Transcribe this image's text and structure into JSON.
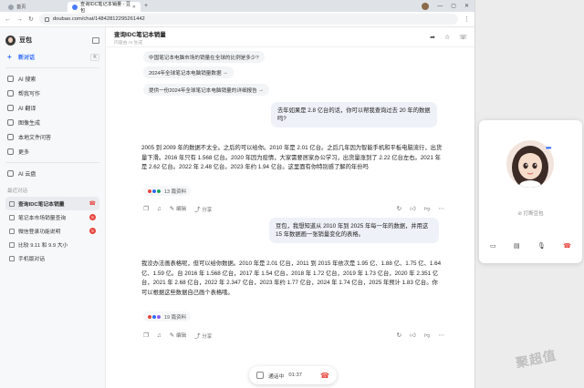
{
  "browser": {
    "tabs": [
      {
        "label": "首页",
        "active": false
      },
      {
        "label": "查询IDC笔记本销量 - 豆包",
        "active": true
      }
    ],
    "url": "doubao.com/chat/14842812295261442"
  },
  "sidebar": {
    "title": "豆包",
    "new_chat": "新对话",
    "new_chat_kbd": "K",
    "items": [
      {
        "label": "AI 搜索",
        "icon": "search-icon"
      },
      {
        "label": "帮我写作",
        "icon": "pen-icon"
      },
      {
        "label": "AI 翻译",
        "icon": "translate-icon"
      },
      {
        "label": "图像生成",
        "icon": "image-icon"
      },
      {
        "label": "本地文件问答",
        "icon": "file-icon"
      },
      {
        "label": "更多",
        "icon": "more-icon"
      }
    ],
    "cloud": "AI 云盘",
    "history_title": "最近对话",
    "history": [
      {
        "label": "查询IDC笔记本销量",
        "active": true,
        "badge": ""
      },
      {
        "label": "笔记本市场销量查询",
        "active": false,
        "badge": "5"
      },
      {
        "label": "微信登录功能说明",
        "active": false,
        "badge": "5"
      },
      {
        "label": "比较 9.11 和 9.9 大小",
        "active": false,
        "badge": ""
      },
      {
        "label": "手机版对话",
        "active": false,
        "badge": ""
      }
    ]
  },
  "chat": {
    "title": "查询IDC笔记本销量",
    "subtitle": "内容由 AI 生成",
    "chips": [
      "中国笔记本电脑市场的销量在全球的比例是多少?",
      "2024年全球笔记本电脑销量数据",
      "提供一份2024年全球笔记本电脑销量的详细报告"
    ],
    "user_msg_1": "去年如果是 2.8 亿台的话，你可以帮我查询过去 20 年的数据吗?",
    "reply_1": "2005 到 2009 年的数据不太全。之后的可以给你。2010 年是 2.01 亿台。之后几年因为智能手机和平板电脑流行，出货量下滑。2016 年只有 1.568 亿台。2020 年因为疫情，大家需要居家办公学习，出货量涨到了 2.22 亿台左右。2021 年是 2.62 亿台。2022 年 2.48 亿台。2023 年约 1.94 亿台。这里面有你特别感了解的年份吗",
    "refs_1": "13 篇资料",
    "user_msg_2": "豆包，我想知道从 2010 年到 2025 年每一年的数据，并用这 15 年数据画一张销量变化的表格。",
    "reply_2": "我没办法画表格呢，但可以给你数据。2010 年是 2.01 亿台，2011 到 2015 年依次是 1.95 亿、1.88 亿、1.75 亿、1.64 亿、1.59 亿。台 2016 年 1.568 亿台，2017 年 1.54 亿台，2018 年 1.72 亿台，2019 年 1.73 亿台，2020 年 2.351 亿台，2021 年 2.68 亿台，2022 年 2.347 亿台，2023 年约 1.77 亿台，2024 年 1.74 亿台，2025 年预计 1.83 亿台。你可以根据这些数据自己画个表格哦。",
    "refs_2": "19 篇资料",
    "edit_label": "编辑",
    "share_label": "分享",
    "call_status": "通话中",
    "call_time": "01:37"
  },
  "call_panel": {
    "interrupt_label": "打断豆包"
  },
  "colors": {
    "accent": "#2f6bff",
    "danger": "#e8453c"
  }
}
